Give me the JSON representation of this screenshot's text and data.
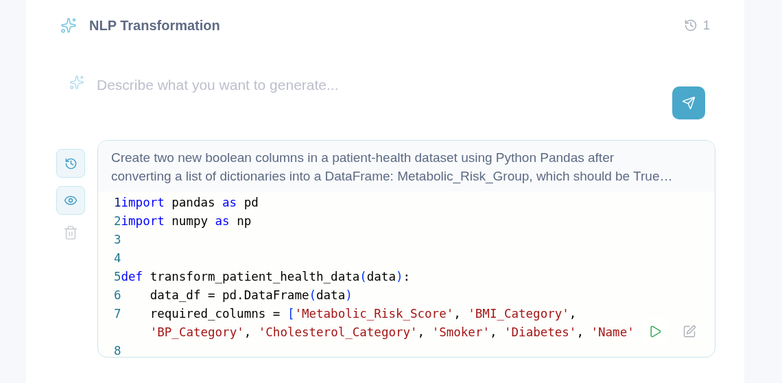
{
  "header": {
    "title": "NLP Transformation",
    "history_count": "1"
  },
  "prompt": {
    "placeholder": "Describe what you want to generate..."
  },
  "entry": {
    "prompt": "Create two new boolean columns in a patient-health dataset using Python Pandas after converting a list of dictionaries into a DataFrame: Metabolic_Risk_Group, which should be True…",
    "code_lines": [
      {
        "number": "1",
        "tokens": [
          {
            "kind": "keyword",
            "text": "import"
          },
          {
            "kind": "plain",
            "text": " pandas "
          },
          {
            "kind": "keyword",
            "text": "as"
          },
          {
            "kind": "plain",
            "text": " pd"
          }
        ]
      },
      {
        "number": "2",
        "tokens": [
          {
            "kind": "keyword",
            "text": "import"
          },
          {
            "kind": "plain",
            "text": " numpy "
          },
          {
            "kind": "keyword",
            "text": "as"
          },
          {
            "kind": "plain",
            "text": " np"
          }
        ]
      },
      {
        "number": "3"
      },
      {
        "number": "4"
      },
      {
        "number": "5",
        "tokens": [
          {
            "kind": "keyword",
            "text": "def"
          },
          {
            "kind": "plain",
            "text": " transform_patient_health_data"
          },
          {
            "kind": "bracket",
            "text": "("
          },
          {
            "kind": "plain",
            "text": "data"
          },
          {
            "kind": "bracket",
            "text": ")"
          },
          {
            "kind": "plain",
            "text": ":"
          }
        ]
      },
      {
        "number": "6",
        "tokens": [
          {
            "kind": "plain",
            "text": "    data_df = pd.DataFrame"
          },
          {
            "kind": "bracket",
            "text": "("
          },
          {
            "kind": "plain",
            "text": "data"
          },
          {
            "kind": "bracket",
            "text": ")"
          }
        ]
      },
      {
        "number": "7",
        "tokens": [
          {
            "kind": "plain",
            "text": "    required_columns = "
          },
          {
            "kind": "bracket",
            "text": "["
          },
          {
            "kind": "string",
            "text": "'Metabolic_Risk_Score'"
          },
          {
            "kind": "plain",
            "text": ", "
          },
          {
            "kind": "string",
            "text": "'BMI_Category'"
          },
          {
            "kind": "plain",
            "text": ","
          }
        ],
        "wrap_tokens": [
          {
            "kind": "string",
            "text": "'BP_Category'"
          },
          {
            "kind": "plain",
            "text": ", "
          },
          {
            "kind": "string",
            "text": "'Cholesterol_Category'"
          },
          {
            "kind": "plain",
            "text": ", "
          },
          {
            "kind": "string",
            "text": "'Smoker'"
          },
          {
            "kind": "plain",
            "text": ", "
          },
          {
            "kind": "string",
            "text": "'Diabetes'"
          },
          {
            "kind": "plain",
            "text": ", "
          },
          {
            "kind": "string",
            "text": "'Name'"
          }
        ]
      },
      {
        "number": "8"
      }
    ]
  }
}
